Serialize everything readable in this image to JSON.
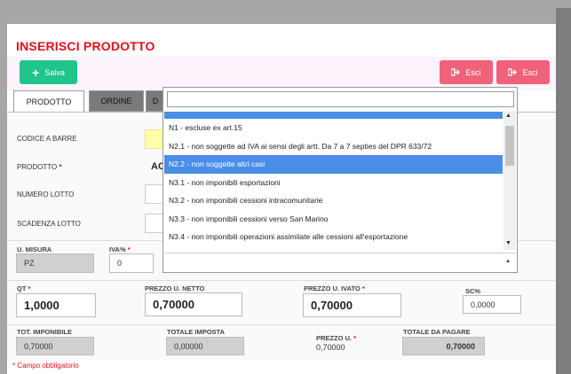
{
  "header": {
    "title": "INSERISCI PRODOTTO",
    "save_label": "Salva",
    "exit_label_1": "Esci",
    "exit_label_2": "Esci"
  },
  "tabs": [
    {
      "label": "PRODOTTO"
    },
    {
      "label": "ORDINE"
    },
    {
      "label": "D"
    }
  ],
  "form": {
    "codice_barre_label": "CODICE A BARRE",
    "prodotto_label": "PRODOTTO",
    "prodotto_value": "AC",
    "numero_lotto_label": "NUMERO LOTTO",
    "scadenza_lotto_label": "SCADENZA LOTTO",
    "req_mark": "*"
  },
  "row2": {
    "umisura_label": "U. MISURA",
    "umisura_value": "PZ",
    "iva_label": "IVA%",
    "iva_value": "0"
  },
  "row3": {
    "qt_label": "QT",
    "qt_value": "1,0000",
    "prezzo_netto_label": "PREZZO U. NETTO",
    "prezzo_netto_value": "0,70000",
    "prezzo_ivato_label": "PREZZO U. IVATO",
    "prezzo_ivato_value": "0,70000",
    "sc_label": "SC%",
    "sc_value": "0,0000"
  },
  "row4": {
    "tot_imponibile_label": "TOT. IMPONIBILE",
    "tot_imponibile_value": "0,70000",
    "totale_imposta_label": "TOTALE IMPOSTA",
    "totale_imposta_value": "0,00000",
    "prezzo_u_label": "PREZZO U.",
    "prezzo_u_value": "0,70000",
    "totale_pagare_label": "TOTALE DA PAGARE",
    "totale_pagare_value": "0,70000"
  },
  "footer": {
    "required_note": "* Campo obbligatorio"
  },
  "dropdown": {
    "search_value": "",
    "options": [
      {
        "label": "N1 - escluse ex art.15"
      },
      {
        "label": "N2.1 - non soggette ad IVA ai sensi degli artt. Da 7 a 7 septies del DPR 633/72"
      },
      {
        "label": "N2.2 - non soggette altri casi"
      },
      {
        "label": "N3.1 - non imponibili esportazioni"
      },
      {
        "label": "N3.2 - non imponibili cessioni intracomunitarie"
      },
      {
        "label": "N3.3 - non imponibili cessioni verso San Marino"
      },
      {
        "label": "N3.4 - non imponibili operazioni assimilate alle cessioni all'esportazione"
      }
    ],
    "highlighted_index": 2
  },
  "icons": {
    "save": "plus-icon",
    "exit": "sign-out-icon",
    "scroll_up": "triangle-up-icon",
    "scroll_down": "triangle-down-icon"
  },
  "colors": {
    "title": "#e0101e",
    "save_button": "#20c58c",
    "exit_button": "#f0627a",
    "highlight": "#4a8ee8",
    "required_field": "#ffffa8"
  }
}
